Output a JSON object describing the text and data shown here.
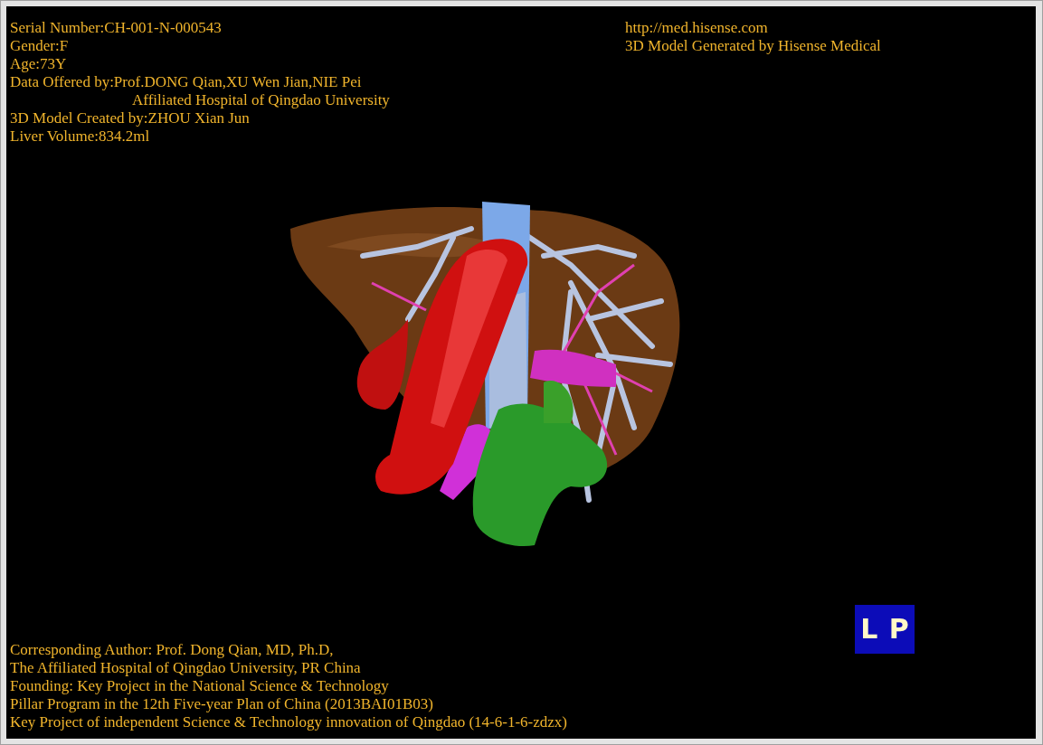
{
  "patient_info": [
    "Serial Number:CH-001-N-000543",
    "Gender:F",
    "Age:73Y",
    "Data Offered by:Prof.DONG Qian,XU Wen Jian,NIE Pei"
  ],
  "data_affiliation": "Affiliated Hospital of Qingdao University",
  "model_info": [
    "3D Model Created by:ZHOU Xian Jun",
    "Liver Volume:834.2ml"
  ],
  "info_top_right": [
    "http://med.hisense.com",
    "3D Model Generated by Hisense Medical"
  ],
  "info_bottom": [
    "Corresponding Author: Prof. Dong Qian, MD, Ph.D,",
    "The Affiliated Hospital of Qingdao University, PR China",
    "Founding: Key Project in the National Science & Technology",
    "Pillar Program in the 12th Five-year Plan of China (2013BAI01B03)",
    "Key Project of independent Science & Technology innovation of Qingdao (14-6-1-6-zdzx)"
  ],
  "orientation_cube": {
    "faces": [
      "L",
      "P"
    ]
  }
}
